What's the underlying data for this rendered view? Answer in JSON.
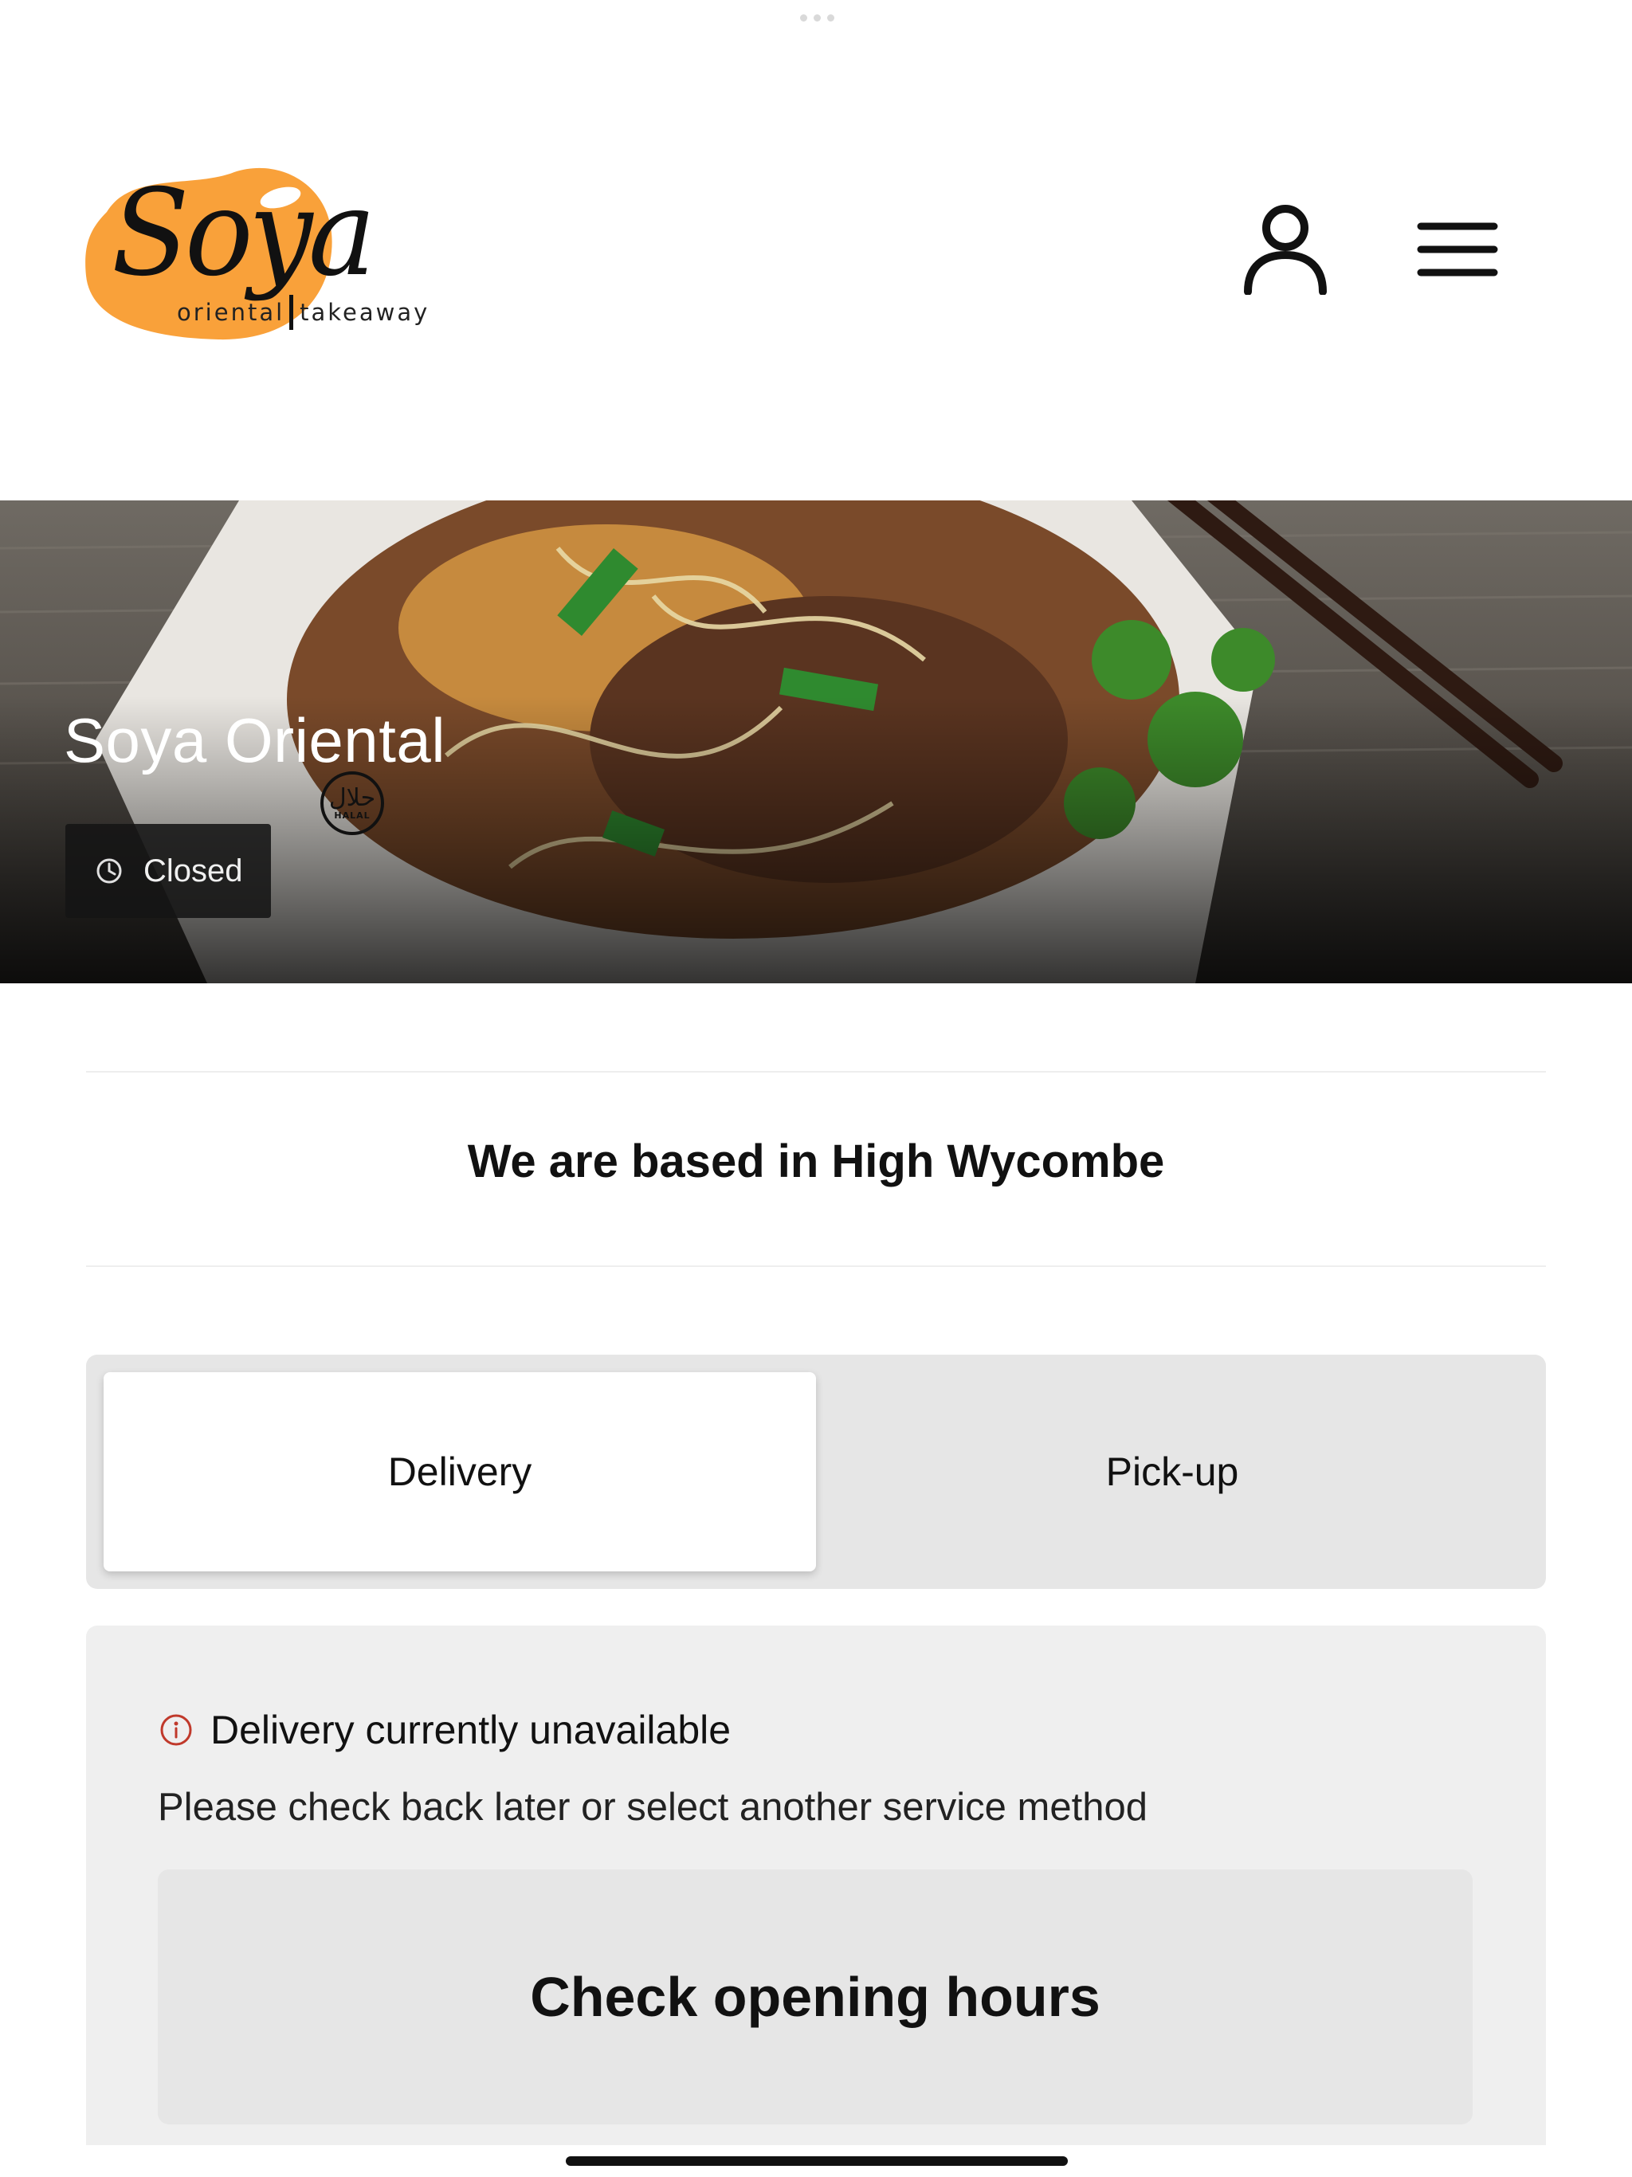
{
  "header": {
    "logo": {
      "wordmark": "Soya",
      "subtitle_left": "oriental",
      "subtitle_right": "takeaway"
    },
    "account_icon": "user-icon",
    "menu_icon": "hamburger-menu-icon"
  },
  "hero": {
    "title": "Soya Oriental",
    "badge": {
      "arabic": "حلال",
      "label": "HALAL"
    },
    "status": {
      "icon": "clock-icon",
      "label": "Closed"
    }
  },
  "location": {
    "text": "We are based in High Wycombe"
  },
  "service_tabs": [
    {
      "label": "Delivery",
      "selected": true
    },
    {
      "label": "Pick-up",
      "selected": false
    }
  ],
  "notice": {
    "icon": "info-icon",
    "heading": "Delivery currently unavailable",
    "body": "Please check back later or select another service method",
    "button_label": "Check opening hours"
  },
  "colors": {
    "brand_orange": "#F9A13A",
    "text": "#111111",
    "tab_track": "#E6E6E6",
    "notice_bg": "#EFEFEF",
    "info_red": "#C0392B"
  }
}
